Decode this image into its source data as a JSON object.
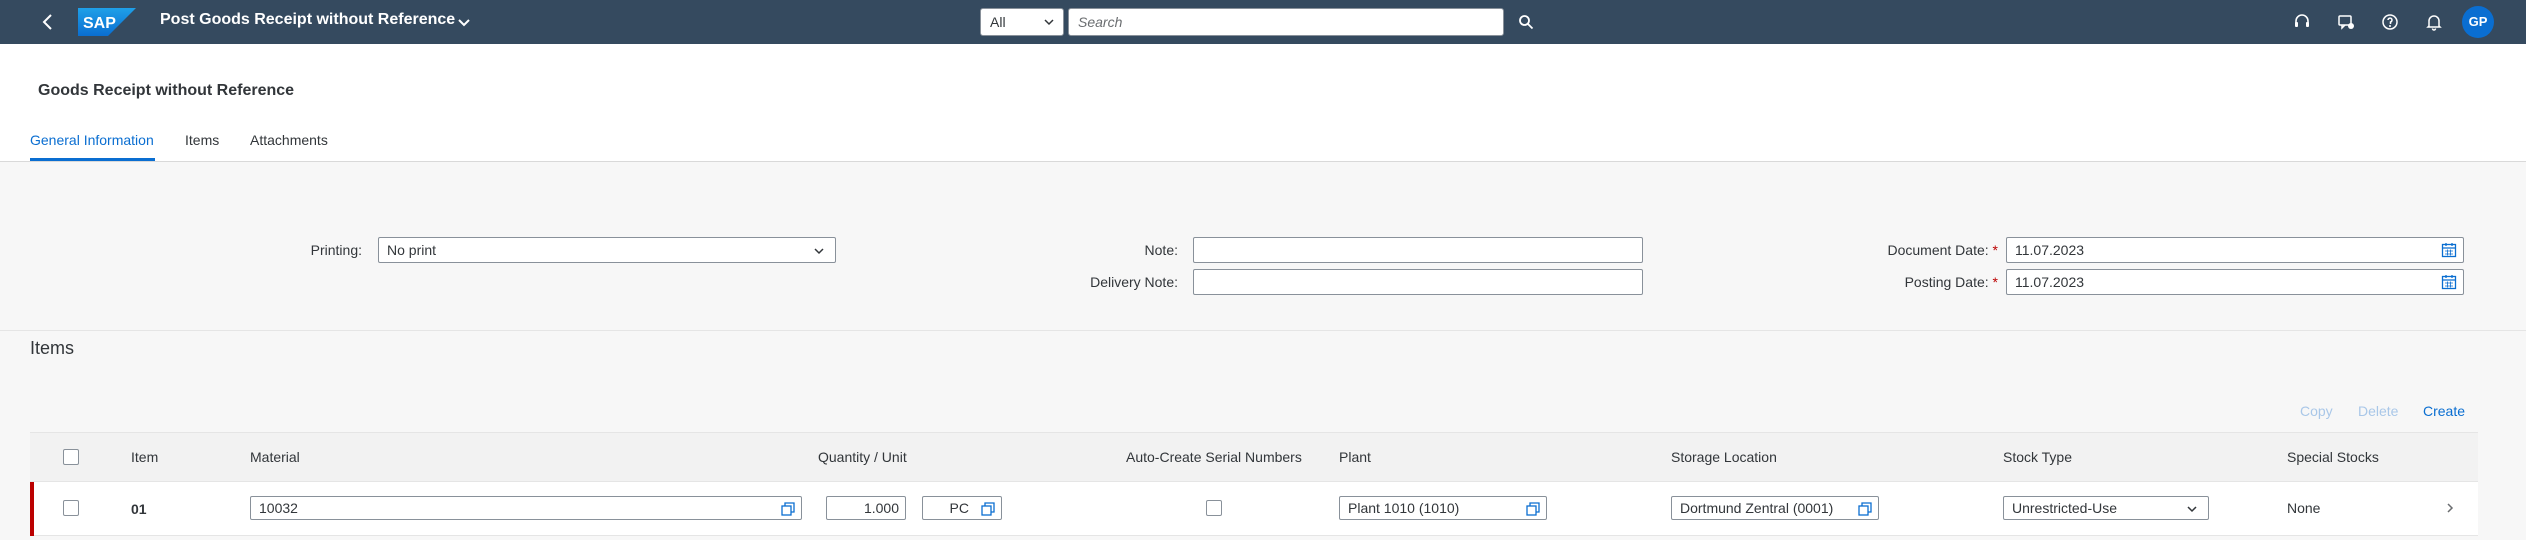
{
  "shell": {
    "title": "Post Goods Receipt without Reference",
    "scope": "All",
    "search_placeholder": "Search",
    "avatar_initials": "GP",
    "logo_text": "SAP"
  },
  "page": {
    "title": "Goods Receipt without Reference",
    "tabs": [
      "General Information",
      "Items",
      "Attachments"
    ]
  },
  "form": {
    "printing_label": "Printing:",
    "printing_value": "No print",
    "note_label": "Note:",
    "note_value": "",
    "delivery_note_label": "Delivery Note:",
    "delivery_note_value": "",
    "document_date_label": "Document Date:",
    "document_date_value": "11.07.2023",
    "posting_date_label": "Posting Date:",
    "posting_date_value": "11.07.2023",
    "required_mark": "*"
  },
  "items": {
    "title": "Items",
    "actions": {
      "copy": "Copy",
      "delete": "Delete",
      "create": "Create"
    },
    "columns": [
      "Item",
      "Material",
      "Quantity / Unit",
      "Auto-Create Serial Numbers",
      "Plant",
      "Storage Location",
      "Stock Type",
      "Special Stocks"
    ],
    "rows": [
      {
        "item": "01",
        "material": "10032",
        "quantity": "1.000",
        "unit": "PC",
        "plant": "Plant 1010 (1010)",
        "storage_location": "Dortmund Zentral (0001)",
        "stock_type": "Unrestricted-Use",
        "special_stocks": "None"
      }
    ]
  },
  "colors": {
    "shell": "#354a5f",
    "accent": "#0a6ed1",
    "required": "#bb0000"
  }
}
